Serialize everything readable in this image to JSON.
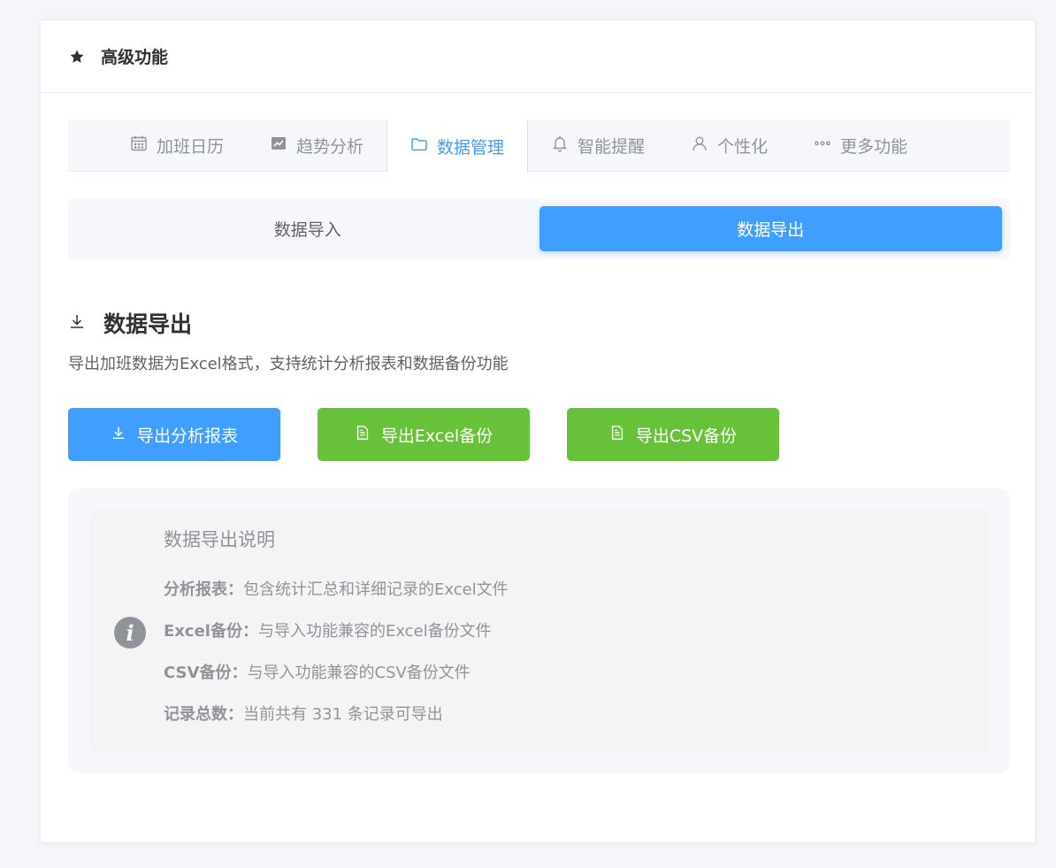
{
  "header": {
    "title": "高级功能",
    "icon": "star-icon"
  },
  "tabs": [
    {
      "label": "加班日历",
      "icon": "calendar-icon",
      "active": false
    },
    {
      "label": "趋势分析",
      "icon": "trend-chart-icon",
      "active": false
    },
    {
      "label": "数据管理",
      "icon": "folder-icon",
      "active": true
    },
    {
      "label": "智能提醒",
      "icon": "bell-icon",
      "active": false
    },
    {
      "label": "个性化",
      "icon": "user-icon",
      "active": false
    },
    {
      "label": "更多功能",
      "icon": "more-dots-icon",
      "active": false
    }
  ],
  "segment": {
    "import_label": "数据导入",
    "export_label": "数据导出",
    "active": "export"
  },
  "section": {
    "title": "数据导出",
    "description": "导出加班数据为Excel格式，支持统计分析报表和数据备份功能"
  },
  "buttons": {
    "report": "导出分析报表",
    "excel": "导出Excel备份",
    "csv": "导出CSV备份"
  },
  "info": {
    "title": "数据导出说明",
    "lines": [
      {
        "label": "分析报表：",
        "text": "包含统计汇总和详细记录的Excel文件"
      },
      {
        "label": "Excel备份：",
        "text": "与导入功能兼容的Excel备份文件"
      },
      {
        "label": "CSV备份：",
        "text": "与导入功能兼容的CSV备份文件"
      },
      {
        "label": "记录总数：",
        "text": "当前共有 331 条记录可导出"
      }
    ]
  },
  "colors": {
    "primary": "#409eff",
    "success": "#67c23a",
    "text_secondary": "#909399"
  }
}
